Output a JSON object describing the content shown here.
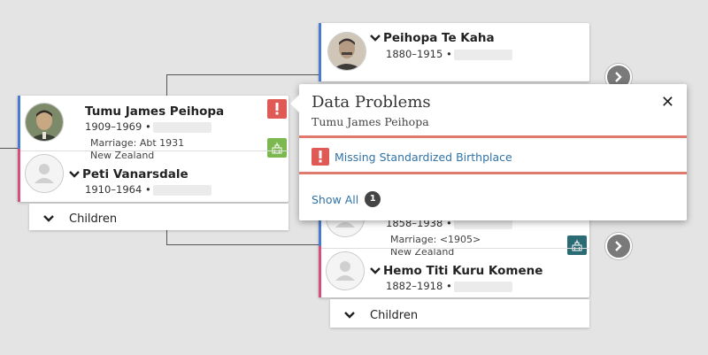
{
  "left_couple": {
    "husband": {
      "name": "Tumu James Peihopa",
      "dates": "1909–1969 •"
    },
    "marriage": {
      "line1": "Marriage: Abt 1931",
      "line2": "New Zealand"
    },
    "wife": {
      "name": "Peti Vanarsdale",
      "dates": "1910–1964 •"
    },
    "children_label": "Children"
  },
  "top_couple": {
    "husband": {
      "name": "Peihopa Te Kaha",
      "dates": "1880–1915 •"
    }
  },
  "bottom_couple": {
    "husband": {
      "dates": "1858–1938 •"
    },
    "marriage": {
      "line1": "Marriage: <1905>",
      "line2": "New Zealand"
    },
    "wife": {
      "name": "Hemo Titi Kuru Komene",
      "dates": "1882–1918 •"
    },
    "children_label": "Children"
  },
  "popup": {
    "title": "Data Problems",
    "subtitle": "Tumu James Peihopa",
    "close_label": "✕",
    "problem_label": "Missing Standardized Birthplace",
    "show_all_label": "Show All",
    "count": "1"
  },
  "colors": {
    "male_bar": "#4a7bd4",
    "female_bar": "#d64f7d",
    "problem_red": "#e05a55",
    "temple_green": "#7bb84f",
    "temple_teal": "#2a6b74",
    "link_blue": "#2f73a8"
  },
  "icons": {
    "problem": "exclamation-icon",
    "temple": "temple-icon",
    "expand": "chevron-down-icon",
    "next": "chevron-right-icon",
    "close": "close-icon"
  }
}
